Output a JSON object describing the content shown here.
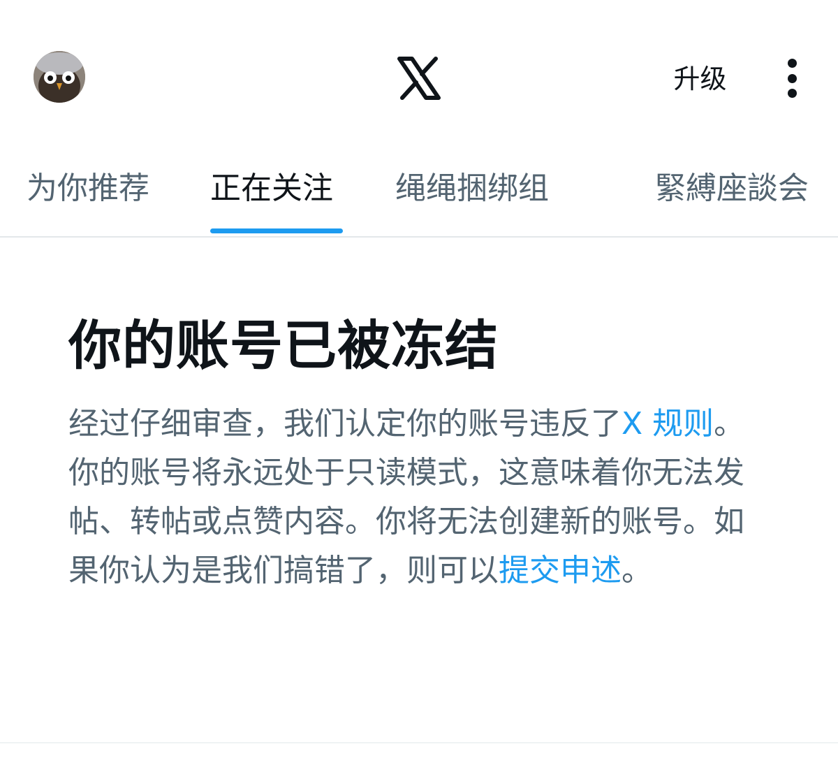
{
  "header": {
    "logo_icon": "x-logo-icon",
    "upgrade_label": "升级",
    "more_icon": "more-vertical-icon"
  },
  "tabs": [
    {
      "label": "为你推荐",
      "active": false
    },
    {
      "label": "正在关注",
      "active": true
    },
    {
      "label": "绳绳捆绑组",
      "active": false
    },
    {
      "label": "緊縛座談会",
      "active": false
    }
  ],
  "notice": {
    "title": "你的账号已被冻结",
    "body_part1": "经过仔细审查，我们认定你的账号违反了",
    "rules_link": "X 规则",
    "body_part2": "。你的账号将永远处于只读模式，这意味着你无法发帖、转帖或点赞内容。你将无法创建新的账号。如果你认为是我们搞错了，则可以",
    "appeal_link": "提交申述",
    "body_part3": "。"
  },
  "colors": {
    "accent": "#1d9bf0",
    "text_primary": "#0f1419",
    "text_secondary": "#536471",
    "divider": "#e3e7ea"
  }
}
